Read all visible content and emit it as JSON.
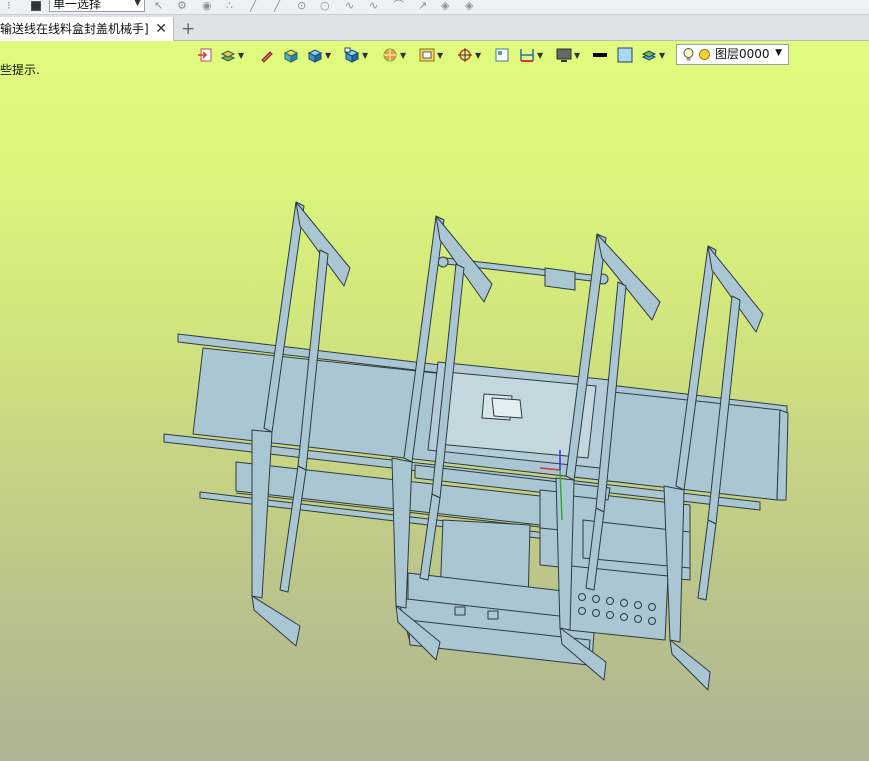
{
  "toolbar": {
    "select_mode": "单一选择"
  },
  "tabs": {
    "active_label": "输送线在线料盒封盖机械手]",
    "close_glyph": "✕",
    "add_glyph": "+"
  },
  "viewport": {
    "hint_text": "些提示."
  },
  "view_toolbar": {
    "layer_label": "图层0000"
  },
  "colors": {
    "model_fill": "#a9c6d2",
    "model_stroke": "#2e3b41",
    "background_top": "#e0fb7d",
    "background_bottom": "#adb393"
  }
}
